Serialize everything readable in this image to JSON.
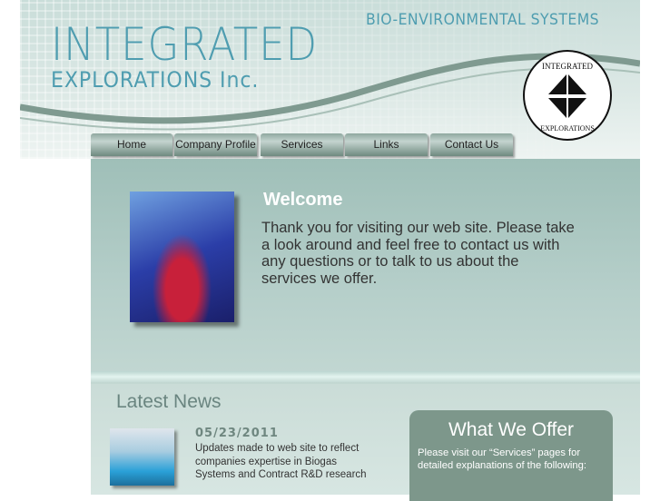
{
  "header": {
    "brand_line1": "INTEGRATED",
    "brand_line2": "EXPLORATIONS Inc.",
    "tagline": "BIO-ENVIRONMENTAL SYSTEMS",
    "logo_text": "INTEGRATED EXPLORATIONS"
  },
  "nav": [
    {
      "label": "Home"
    },
    {
      "label": "Company Profile"
    },
    {
      "label": "Services"
    },
    {
      "label": "Links"
    },
    {
      "label": "Contact Us"
    }
  ],
  "welcome": {
    "title": "Welcome",
    "text": "Thank you for visiting our web site. Please take a look around and feel free to contact us with any questions or to talk to us about the services we offer."
  },
  "news": {
    "title": "Latest News",
    "items": [
      {
        "date": "05/23/2011",
        "text": "Updates made to web site to reflect companies expertise in Biogas Systems and Contract R&D research"
      }
    ]
  },
  "offer": {
    "title": "What We Offer",
    "text": "Please visit our “Services” pages for detailed explanations of the following:"
  }
}
